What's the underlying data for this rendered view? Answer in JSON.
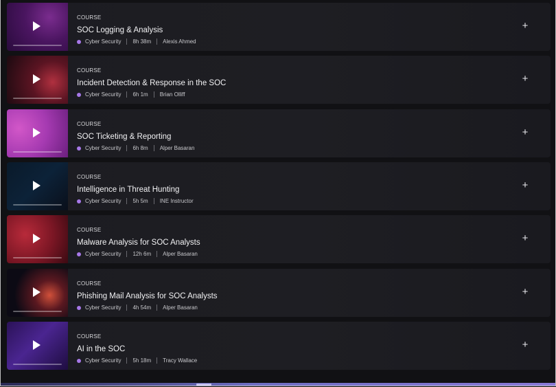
{
  "courses": [
    {
      "kicker": "COURSE",
      "title": "SOC Logging & Analysis",
      "category": "Cyber Security",
      "duration": "8h 38m",
      "instructor": "Alexis Ahmed"
    },
    {
      "kicker": "COURSE",
      "title": "Incident Detection & Response in the SOC",
      "category": "Cyber Security",
      "duration": "6h 1m",
      "instructor": "Brian Olliff"
    },
    {
      "kicker": "COURSE",
      "title": "SOC Ticketing & Reporting",
      "category": "Cyber Security",
      "duration": "6h 8m",
      "instructor": "Alper Basaran"
    },
    {
      "kicker": "COURSE",
      "title": "Intelligence in Threat Hunting",
      "category": "Cyber Security",
      "duration": "5h 5m",
      "instructor": "INE Instructor"
    },
    {
      "kicker": "COURSE",
      "title": "Malware Analysis for SOC Analysts",
      "category": "Cyber Security",
      "duration": "12h 6m",
      "instructor": "Alper Basaran"
    },
    {
      "kicker": "COURSE",
      "title": "Phishing Mail Analysis for SOC Analysts",
      "category": "Cyber Security",
      "duration": "4h 54m",
      "instructor": "Alper Basaran"
    },
    {
      "kicker": "COURSE",
      "title": "AI in the SOC",
      "category": "Cyber Security",
      "duration": "5h 18m",
      "instructor": "Tracy Wallace"
    }
  ],
  "icons": {
    "play": "play-icon",
    "add": "plus-icon",
    "category_dot": "category-dot-icon"
  },
  "colors": {
    "category_dot": "#a778e8",
    "card_bg": "#1d1d22",
    "page_bg": "#111114"
  },
  "add_symbol": "+"
}
